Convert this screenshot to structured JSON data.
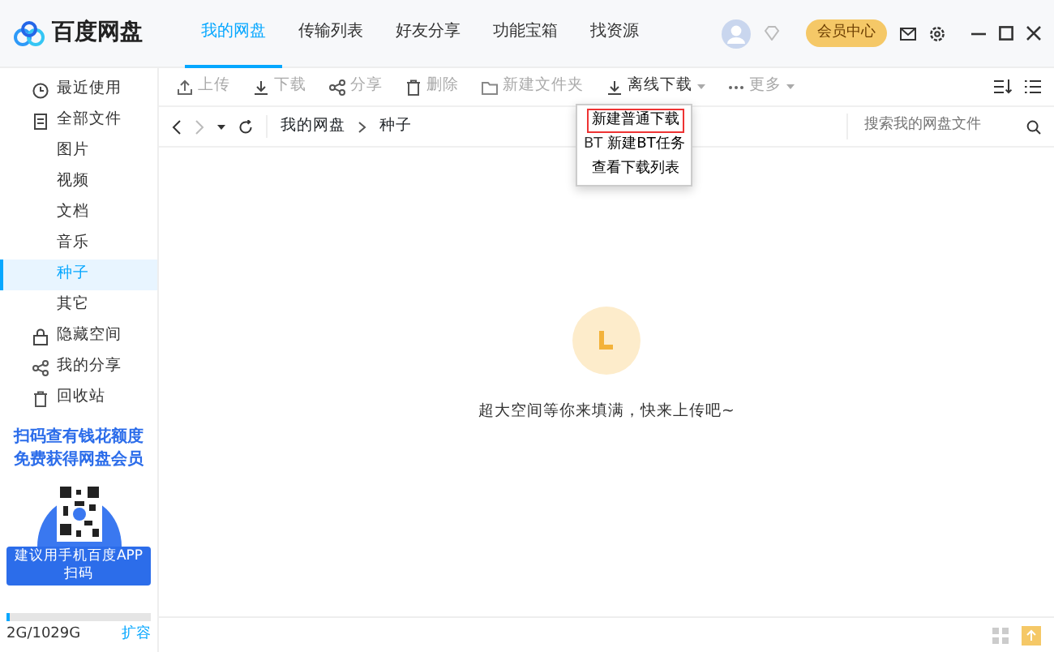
{
  "app": {
    "name": "百度网盘"
  },
  "tabs": [
    {
      "label": "我的网盘",
      "selected": true
    },
    {
      "label": "传输列表",
      "selected": false
    },
    {
      "label": "好友分享",
      "selected": false
    },
    {
      "label": "功能宝箱",
      "selected": false
    },
    {
      "label": "找资源",
      "selected": false
    }
  ],
  "header": {
    "vip_button": "会员中心"
  },
  "sidebar": {
    "items": [
      {
        "label": "最近使用",
        "kind": "top",
        "selected": false
      },
      {
        "label": "全部文件",
        "kind": "top",
        "selected": false
      },
      {
        "label": "图片",
        "kind": "sub",
        "selected": false
      },
      {
        "label": "视频",
        "kind": "sub",
        "selected": false
      },
      {
        "label": "文档",
        "kind": "sub",
        "selected": false
      },
      {
        "label": "音乐",
        "kind": "sub",
        "selected": false
      },
      {
        "label": "种子",
        "kind": "sub",
        "selected": true
      },
      {
        "label": "其它",
        "kind": "sub",
        "selected": false
      },
      {
        "label": "隐藏空间",
        "kind": "top",
        "selected": false
      },
      {
        "label": "我的分享",
        "kind": "top",
        "selected": false
      },
      {
        "label": "回收站",
        "kind": "top",
        "selected": false
      }
    ],
    "promo": {
      "line_1": "扫码查有钱花额度",
      "line_2": "免费获得网盘会员",
      "caption": "建议用手机百度APP扫码"
    },
    "storage": {
      "level": 0.02,
      "text": "2G/1029G",
      "expand": "扩容"
    }
  },
  "toolbar": [
    {
      "label": "上传",
      "disabled": true,
      "dropdown": false
    },
    {
      "label": "下载",
      "disabled": true,
      "dropdown": false
    },
    {
      "label": "分享",
      "disabled": true,
      "dropdown": false
    },
    {
      "label": "删除",
      "disabled": true,
      "dropdown": false
    },
    {
      "label": "新建文件夹",
      "disabled": true,
      "dropdown": false
    },
    {
      "label": "离线下载",
      "disabled": false,
      "dropdown": true
    },
    {
      "label": "更多",
      "disabled": true,
      "dropdown": true
    }
  ],
  "breadcrumb": [
    "我的网盘",
    "种子"
  ],
  "search": {
    "placeholder": "搜索我的网盘文件"
  },
  "menu": [
    {
      "label": "新建普通下载",
      "highlighted": true
    },
    {
      "label": "新建BT任务",
      "prefix": "BT",
      "highlighted": false
    },
    {
      "label": "查看下载列表",
      "highlighted": false
    }
  ],
  "empty_state": {
    "message": "超大空间等你来填满，快来上传吧~"
  }
}
